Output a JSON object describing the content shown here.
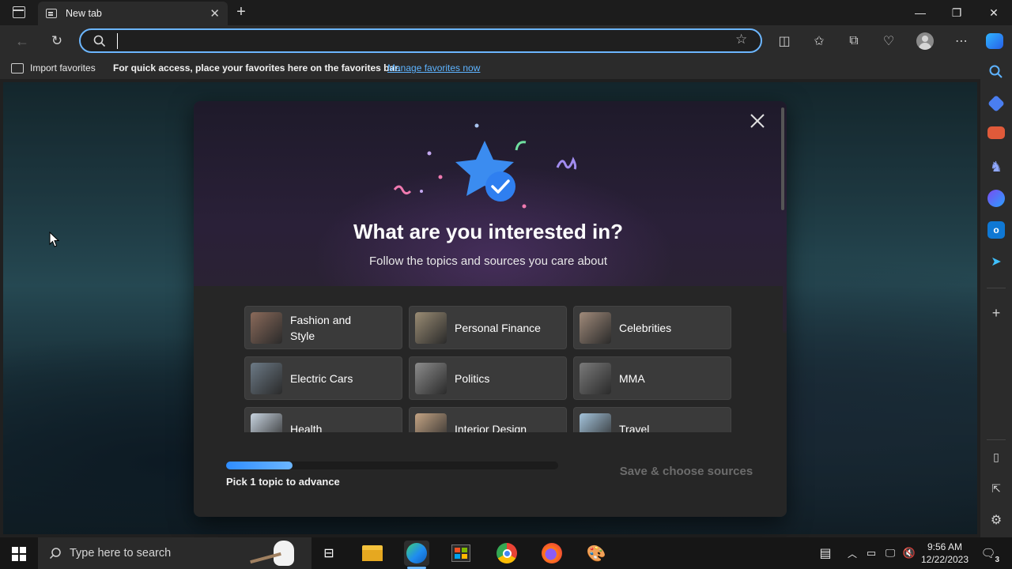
{
  "browser": {
    "tab_title": "New tab",
    "address_value": "",
    "favorites_bar": {
      "import_label": "Import favorites",
      "message": "For quick access, place your favorites here on the favorites bar.",
      "manage_link": "Manage favorites now"
    }
  },
  "modal": {
    "title": "What are you interested in?",
    "subtitle": "Follow the topics and sources you care about",
    "topics": [
      {
        "label": "Fashion and Style",
        "color": "#8a6a5a"
      },
      {
        "label": "Personal Finance",
        "color": "#9a8c74"
      },
      {
        "label": "Celebrities",
        "color": "#a08a7a"
      },
      {
        "label": "Electric Cars",
        "color": "#6c7a86"
      },
      {
        "label": "Politics",
        "color": "#8c8c8c"
      },
      {
        "label": "MMA",
        "color": "#7a7a7a"
      },
      {
        "label": "Health",
        "color": "#c8d4e0"
      },
      {
        "label": "Interior Design",
        "color": "#c4a484"
      },
      {
        "label": "Travel",
        "color": "#a4c4dc"
      }
    ],
    "progress_label": "Pick 1 topic to advance",
    "progress_fraction": 0.2,
    "save_label": "Save & choose sources"
  },
  "taskbar": {
    "search_placeholder": "Type here to search",
    "time": "9:56 AM",
    "date": "12/22/2023",
    "notification_count": "3"
  },
  "colors": {
    "accent": "#6cb6ff",
    "link": "#5db3ff"
  }
}
